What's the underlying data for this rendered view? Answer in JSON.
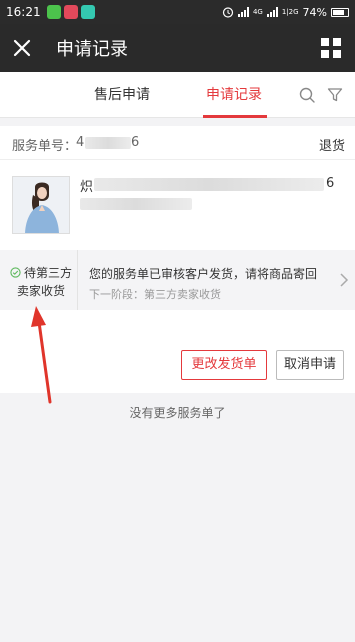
{
  "status_bar": {
    "time": "16:21",
    "network_top": "4G",
    "network_bottom": "1|2G",
    "battery": "74%"
  },
  "app_bar": {
    "title": "申请记录",
    "close_icon": "close-icon",
    "menu_icon": "grid-icon"
  },
  "tabs": {
    "items": [
      {
        "label": "售后申请",
        "active": false
      },
      {
        "label": "申请记录",
        "active": true
      }
    ],
    "search_icon": "search-icon",
    "filter_icon": "filter-icon"
  },
  "record": {
    "service_label": "服务单号：",
    "service_number_visible_prefix": "4",
    "service_number_visible_suffix": "6",
    "type": "退货",
    "product_name_visible_start": "炽",
    "product_name_visible_end": "6",
    "status_title": "待第三方",
    "status_title_line2": "卖家收货",
    "status_message": "您的服务单已审核客户发货，请将商品寄回",
    "next_stage": "下一阶段：第三方卖家收货",
    "change_shipping_button": "更改发货单",
    "cancel_button": "取消申请"
  },
  "footer": {
    "no_more": "没有更多服务单了"
  },
  "colors": {
    "accent": "#e4393c",
    "header_bg": "#2a2a2a",
    "annotation_arrow": "#e0352b"
  }
}
